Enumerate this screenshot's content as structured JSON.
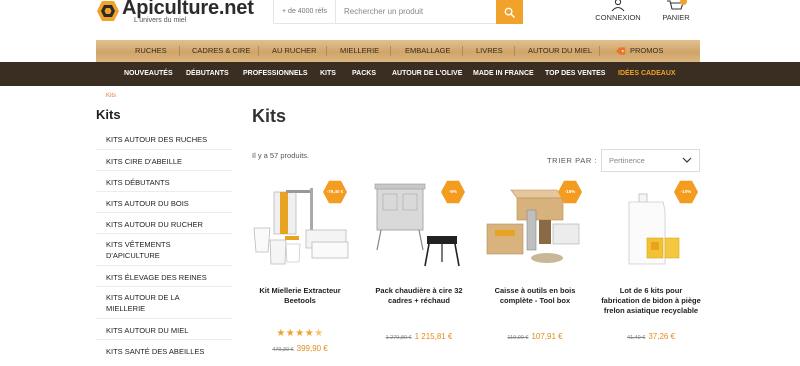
{
  "brand": {
    "name": "Apiculture.net",
    "tagline": "L'univers du miel"
  },
  "search": {
    "count_label": "+ de 4000 réfs",
    "placeholder": "Rechercher un produit"
  },
  "account": {
    "login_label": "CONNEXION",
    "cart_label": "PANIER"
  },
  "nav_primary": [
    {
      "label": "RUCHES"
    },
    {
      "label": "CADRES & CIRE"
    },
    {
      "label": "AU RUCHER"
    },
    {
      "label": "MIELLERIE"
    },
    {
      "label": "EMBALLAGE"
    },
    {
      "label": "LIVRES"
    },
    {
      "label": "AUTOUR DU MIEL"
    },
    {
      "label": "PROMOS"
    }
  ],
  "nav_secondary": [
    {
      "label": "NOUVEAUTÉS"
    },
    {
      "label": "DÉBUTANTS"
    },
    {
      "label": "PROFESSIONNELS"
    },
    {
      "label": "KITS"
    },
    {
      "label": "PACKS"
    },
    {
      "label": "AUTOUR DE L'OLIVE"
    },
    {
      "label": "MADE IN FRANCE"
    },
    {
      "label": "TOP DES VENTES"
    },
    {
      "label": "IDÉES CADEAUX"
    }
  ],
  "breadcrumb": {
    "current": "Kits"
  },
  "sidebar": {
    "title": "Kits",
    "items": [
      {
        "label": "KITS AUTOUR DES RUCHES"
      },
      {
        "label": "KITS CIRE D'ABEILLE"
      },
      {
        "label": "KITS DÉBUTANTS"
      },
      {
        "label": "KITS AUTOUR DU BOIS"
      },
      {
        "label": "KITS AUTOUR DU RUCHER"
      },
      {
        "label": "KITS VÊTEMENTS D'APICULTURE"
      },
      {
        "label": "KITS ÉLEVAGE DES REINES"
      },
      {
        "label": "KITS AUTOUR DE LA MIELLERIE"
      },
      {
        "label": "KITS AUTOUR DU MIEL"
      },
      {
        "label": "KITS SANTÉ DES ABEILLES"
      }
    ]
  },
  "main": {
    "title": "Kits",
    "count": "Il y a 57 produits.",
    "sort_label": "TRIER PAR :",
    "sort_value": "Pertinence"
  },
  "products": [
    {
      "badge": "-79,40 €",
      "name": "Kit Miellerie Extracteur Beetools",
      "old_price": "479,30 €",
      "price": "399,90 €",
      "rating": 4.5
    },
    {
      "badge": "-5%",
      "name": "Pack chaudière à cire 32 cadres + réchaud",
      "old_price": "1 279,80 €",
      "price": "1 215,81 €"
    },
    {
      "badge": "-15%",
      "name": "Caisse à outils en bois complète - Tool box",
      "old_price": "119,90 €",
      "price": "107,91 €"
    },
    {
      "badge": "-10%",
      "name": "Lot de 6 kits pour fabrication de bidon à piège frelon asiatique recyclable",
      "old_price": "41,40 €",
      "price": "37,26 €"
    }
  ],
  "colors": {
    "accent": "#f0a22a",
    "dark_nav": "#3a2d22",
    "wood": "#d4aa72",
    "price": "#e68a1c"
  }
}
